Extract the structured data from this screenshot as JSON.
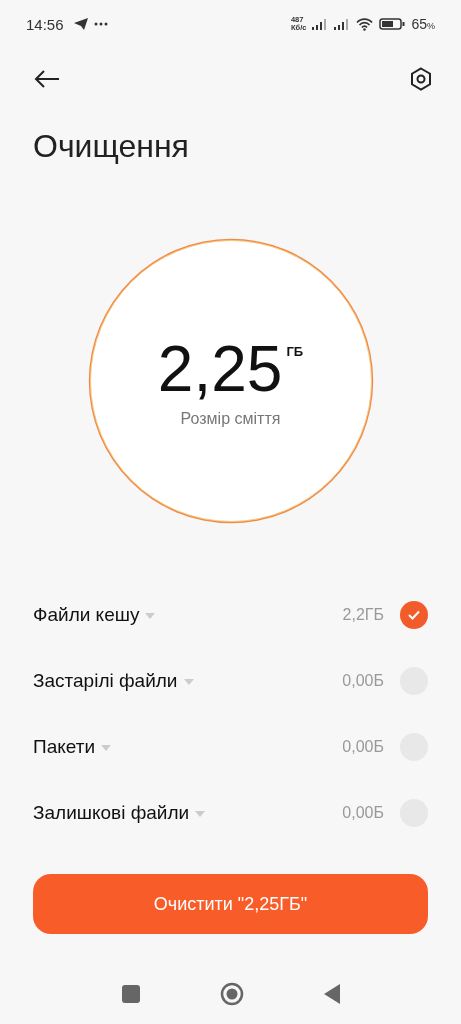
{
  "status_bar": {
    "time": "14:56",
    "speed_value": "487",
    "speed_unit": "Кб/с",
    "battery_level_text": "65",
    "battery_unit": "%"
  },
  "title": "Очищення",
  "summary": {
    "value": "2,25",
    "unit": "ГБ",
    "label": "Розмір сміття"
  },
  "categories": [
    {
      "label": "Файли кешу",
      "size": "2,2ГБ",
      "checked": true
    },
    {
      "label": "Застарілі файли",
      "size": "0,00Б",
      "checked": false
    },
    {
      "label": "Пакети",
      "size": "0,00Б",
      "checked": false
    },
    {
      "label": "Залишкові файли",
      "size": "0,00Б",
      "checked": false
    }
  ],
  "clean_button": "Очистити \"2,25ГБ\""
}
